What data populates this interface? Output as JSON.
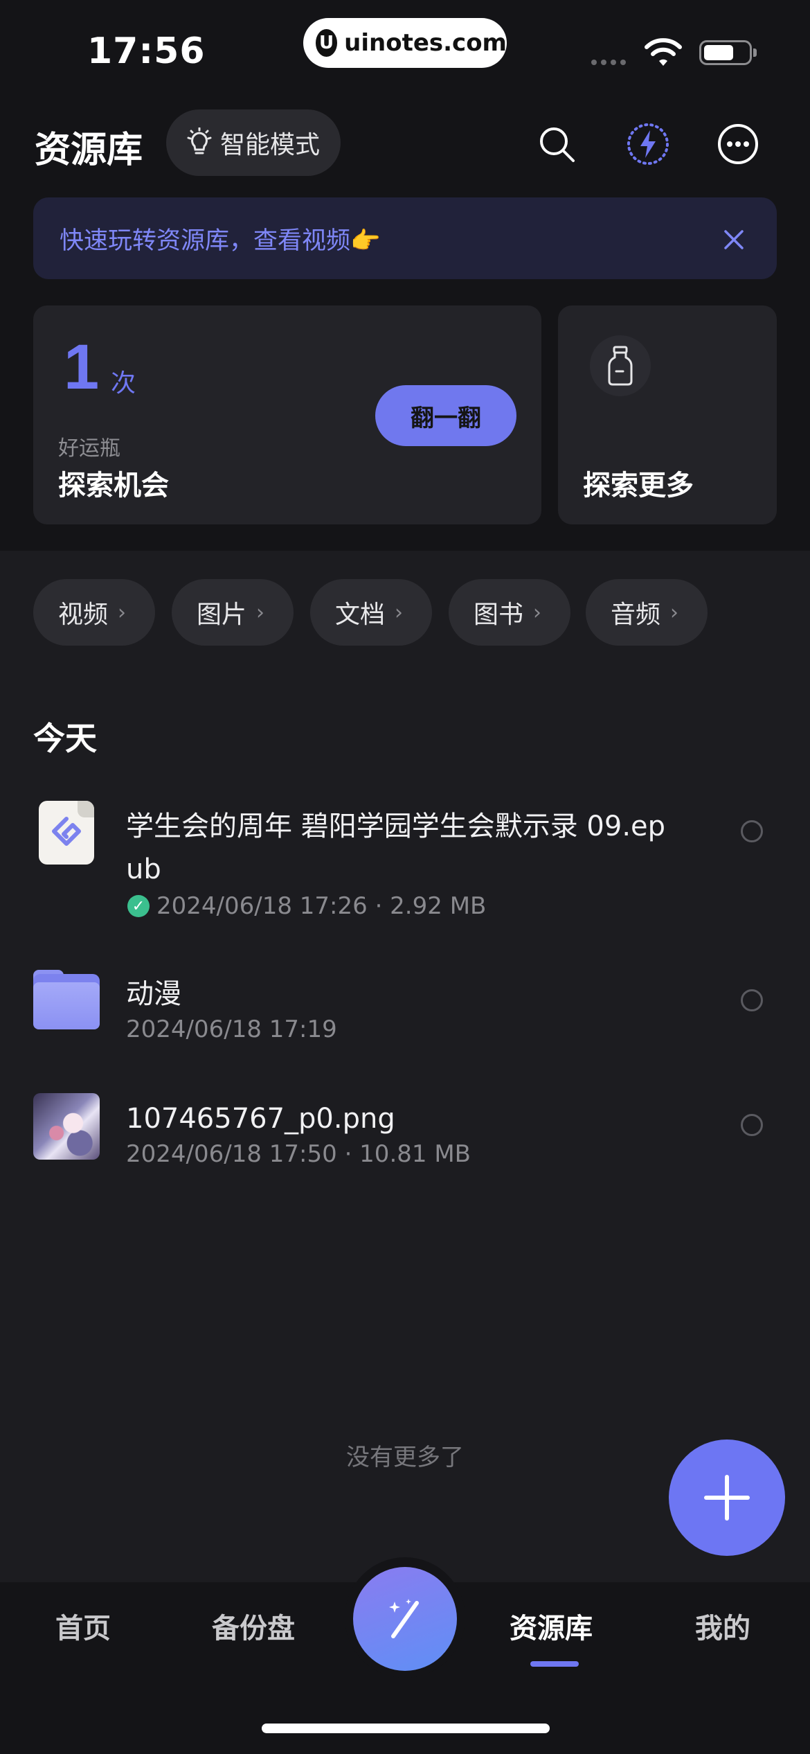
{
  "status_bar": {
    "time": "17:56",
    "pill_logo": "U",
    "pill_text": "uinotes.com"
  },
  "header": {
    "title": "资源库",
    "mode_button": "智能模式",
    "icons": [
      "search-icon",
      "bolt-icon",
      "more-icon"
    ]
  },
  "banner": {
    "text": "快速玩转资源库，查看视频👉"
  },
  "lucky_card": {
    "count": "1",
    "unit": "次",
    "subtitle": "好运瓶",
    "title": "探索机会",
    "button": "翻一翻"
  },
  "explore_card": {
    "title": "探索更多"
  },
  "chips": [
    {
      "label": "视频"
    },
    {
      "label": "图片"
    },
    {
      "label": "文档"
    },
    {
      "label": "图书"
    },
    {
      "label": "音频"
    }
  ],
  "section_title": "今天",
  "files": [
    {
      "name_line1": "学生会的周年 碧阳学园学生会默示录 09.ep",
      "name_line2": "ub",
      "meta": "2024/06/18 17:26 · 2.92 MB"
    },
    {
      "name": "动漫",
      "meta": "2024/06/18 17:19"
    },
    {
      "name": "107465767_p0.png",
      "meta": "2024/06/18 17:50 · 10.81 MB"
    }
  ],
  "no_more": "没有更多了",
  "tabs": [
    {
      "label": "首页"
    },
    {
      "label": "备份盘"
    },
    {
      "label": "资源库"
    },
    {
      "label": "我的"
    }
  ],
  "colors": {
    "accent": "#6f77f2",
    "background": "#1c1c20",
    "top_background": "#141417",
    "success": "#3bbf8e"
  }
}
